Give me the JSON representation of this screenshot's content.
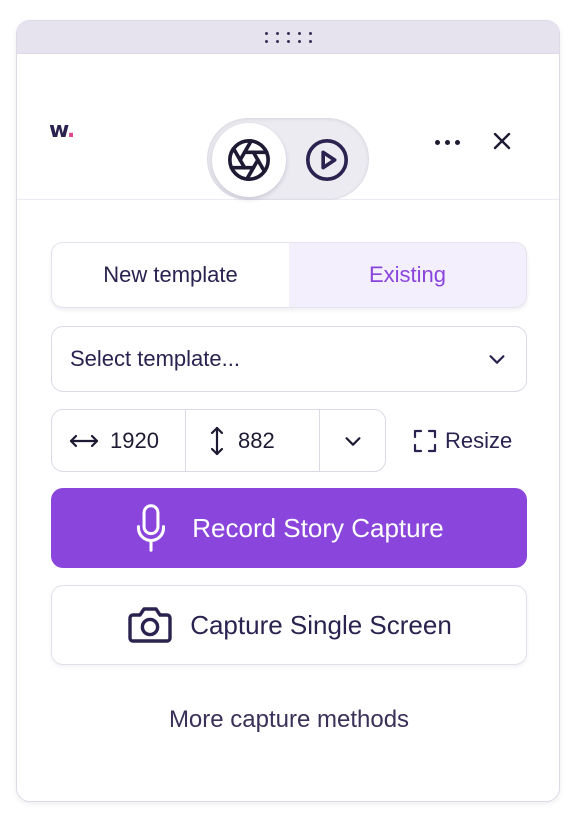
{
  "header": {
    "logo_text": "w",
    "logo_dot": ".",
    "mode_toggle": [
      {
        "name": "screenshot-mode",
        "icon": "aperture-icon",
        "active": true
      },
      {
        "name": "video-mode",
        "icon": "play-circle-icon",
        "active": false
      }
    ],
    "more_icon": "more-horizontal-icon",
    "close_icon": "close-icon"
  },
  "template_tabs": {
    "new_label": "New template",
    "existing_label": "Existing",
    "selected": "Existing"
  },
  "template_select": {
    "placeholder": "Select template..."
  },
  "dimensions": {
    "width": "1920",
    "height": "882",
    "resize_label": "Resize"
  },
  "actions": {
    "record_label": "Record Story Capture",
    "single_label": "Capture Single Screen",
    "more_label": "More capture methods"
  },
  "colors": {
    "accent": "#8a45dc",
    "text": "#2b2250",
    "tab_active_bg": "#f3effc",
    "logo_dot": "#d94a8c"
  }
}
